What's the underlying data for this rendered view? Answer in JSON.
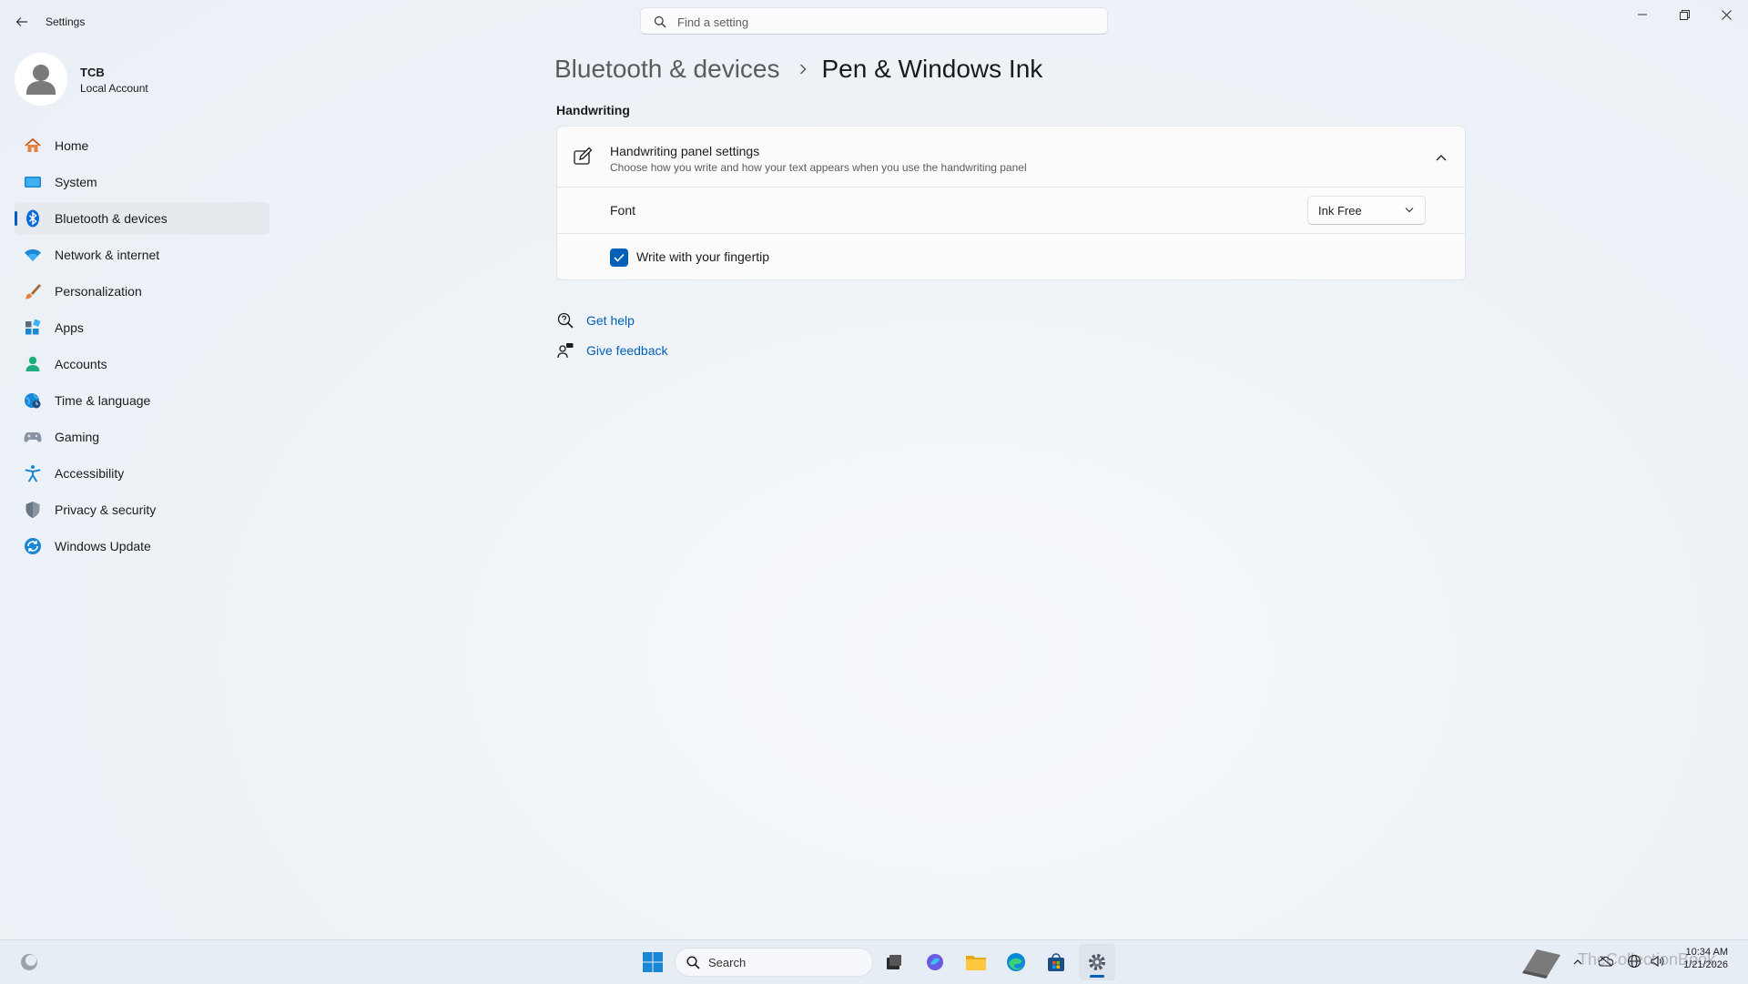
{
  "titlebar": {
    "app_title": "Settings",
    "search_placeholder": "Find a setting"
  },
  "profile": {
    "name": "TCB",
    "account_type": "Local Account"
  },
  "sidebar": {
    "items": [
      {
        "label": "Home",
        "icon": "home-icon"
      },
      {
        "label": "System",
        "icon": "system-icon"
      },
      {
        "label": "Bluetooth & devices",
        "icon": "bluetooth-icon",
        "active": true
      },
      {
        "label": "Network & internet",
        "icon": "wifi-icon"
      },
      {
        "label": "Personalization",
        "icon": "brush-icon"
      },
      {
        "label": "Apps",
        "icon": "apps-icon"
      },
      {
        "label": "Accounts",
        "icon": "person-icon"
      },
      {
        "label": "Time & language",
        "icon": "globe-clock-icon"
      },
      {
        "label": "Gaming",
        "icon": "gamepad-icon"
      },
      {
        "label": "Accessibility",
        "icon": "accessibility-icon"
      },
      {
        "label": "Privacy & security",
        "icon": "shield-icon"
      },
      {
        "label": "Windows Update",
        "icon": "update-icon"
      }
    ]
  },
  "breadcrumb": {
    "parent": "Bluetooth & devices",
    "current": "Pen & Windows Ink"
  },
  "handwriting": {
    "section_title": "Handwriting",
    "panel_title": "Handwriting panel settings",
    "panel_description": "Choose how you write and how your text appears when you use the handwriting panel",
    "font_label": "Font",
    "font_value": "Ink Free",
    "fingertip_label": "Write with your fingertip",
    "fingertip_checked": true
  },
  "links": {
    "get_help": "Get help",
    "give_feedback": "Give feedback"
  },
  "taskbar": {
    "search_label": "Search",
    "time": "10:34 AM",
    "date": "1/21/2026",
    "watermark": "TheCollectionBook"
  },
  "colors": {
    "accent": "#005fb8",
    "background": "#eff4f9",
    "card": "#fbfbfc"
  }
}
